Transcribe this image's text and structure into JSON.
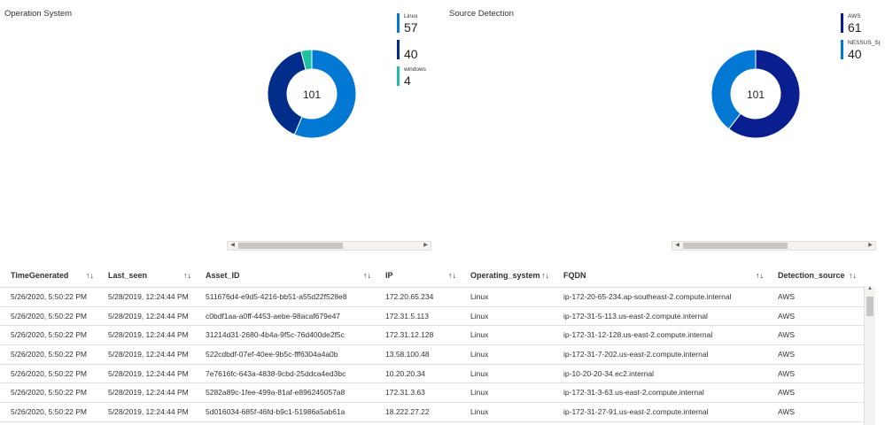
{
  "panels": [
    {
      "title": "Operation System",
      "total": "101",
      "legend": [
        {
          "name": "Linux",
          "value": 57,
          "color": "#0078d4"
        },
        {
          "name": "",
          "value": 40,
          "color": "#002d8a"
        },
        {
          "name": "windows",
          "value": 4,
          "color": "#1ec1a3"
        }
      ]
    },
    {
      "title": "Source Detection",
      "total": "101",
      "legend": [
        {
          "name": "AWS",
          "value": 61,
          "color": "#0a1f8f"
        },
        {
          "name": "NESSUS_S(",
          "value": 40,
          "color": "#0078d4"
        }
      ]
    }
  ],
  "table": {
    "columns": [
      "TimeGenerated",
      "Last_seen",
      "Asset_ID",
      "IP",
      "Operating_system",
      "FQDN",
      "Detection_source"
    ],
    "sort_icon": "↑↓",
    "rows": [
      [
        "5/26/2020, 5:50:22 PM",
        "5/28/2019, 12:24:44 PM",
        "511676d4-e9d5-4216-bb51-a55d22f528e8",
        "172.20.65.234",
        "Linux",
        "ip-172-20-65-234.ap-southeast-2.compute.internal",
        "AWS"
      ],
      [
        "5/26/2020, 5:50:22 PM",
        "5/28/2019, 12:24:44 PM",
        "c0bdf1aa-a0ff-4453-aebe-98acaf679e47",
        "172.31.5.113",
        "Linux",
        "ip-172-31-5-113.us-east-2.compute.internal",
        "AWS"
      ],
      [
        "5/26/2020, 5:50:22 PM",
        "5/28/2019, 12:24:44 PM",
        "31214d31-2680-4b4a-9f5c-76d400de2f5c",
        "172.31.12.128",
        "Linux",
        "ip-172-31-12-128.us-east-2.compute.internal",
        "AWS"
      ],
      [
        "5/26/2020, 5:50:22 PM",
        "5/28/2019, 12:24:44 PM",
        "522cdbdf-07ef-40ee-9b5c-fff6304a4a0b",
        "13.58.100.48",
        "Linux",
        "ip-172-31-7-202.us-east-2.compute.internal",
        "AWS"
      ],
      [
        "5/26/2020, 5:50:22 PM",
        "5/28/2019, 12:24:44 PM",
        "7e7616fc-643a-4838-9cbd-25ddca4ed3bc",
        "10.20.20.34",
        "Linux",
        "ip-10-20-20-34.ec2.internal",
        "AWS"
      ],
      [
        "5/26/2020, 5:50:22 PM",
        "5/28/2019, 12:24:44 PM",
        "5282a89c-1fee-499a-81af-e896245057a8",
        "172.31.3.63",
        "Linux",
        "ip-172-31-3-63.us-east-2.compute.internal",
        "AWS"
      ],
      [
        "5/26/2020, 5:50:22 PM",
        "5/28/2019, 12:24:44 PM",
        "5d016034-685f-46fd-b9c1-51986a5ab61a",
        "18.222.27.22",
        "Linux",
        "ip-172-31-27-91.us-east-2.compute.internal",
        "AWS"
      ]
    ]
  }
}
